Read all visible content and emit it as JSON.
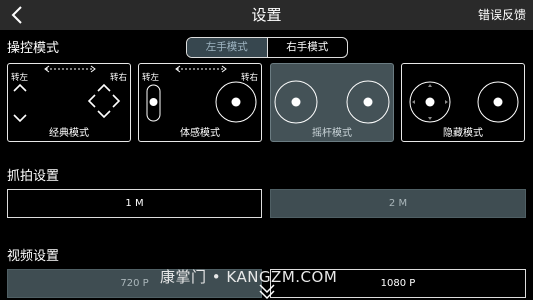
{
  "header": {
    "title": "设置",
    "feedback_label": "错误反馈",
    "back_icon": "chevron-left-icon"
  },
  "control": {
    "section_label": "操控模式",
    "hands": [
      {
        "label": "左手模式",
        "active": true
      },
      {
        "label": "右手模式",
        "active": false
      }
    ],
    "modes": [
      {
        "label": "经典模式",
        "turn_left": "转左",
        "turn_right": "转右",
        "active": false
      },
      {
        "label": "体感模式",
        "turn_left": "转左",
        "turn_right": "转右",
        "active": false
      },
      {
        "label": "摇杆模式",
        "active": true
      },
      {
        "label": "隐藏模式",
        "active": false
      }
    ]
  },
  "capture": {
    "section_label": "抓拍设置",
    "options": [
      {
        "label": "1 M",
        "active": false
      },
      {
        "label": "2 M",
        "active": true
      }
    ]
  },
  "video": {
    "section_label": "视频设置",
    "options": [
      {
        "label": "720 P",
        "active": true
      },
      {
        "label": "1080 P",
        "active": false
      }
    ]
  },
  "watermark": "康掌门 • KANGZM.COM",
  "colors": {
    "active_fill": "#445257",
    "topbar": "#2a2a2a",
    "background": "#000000"
  }
}
